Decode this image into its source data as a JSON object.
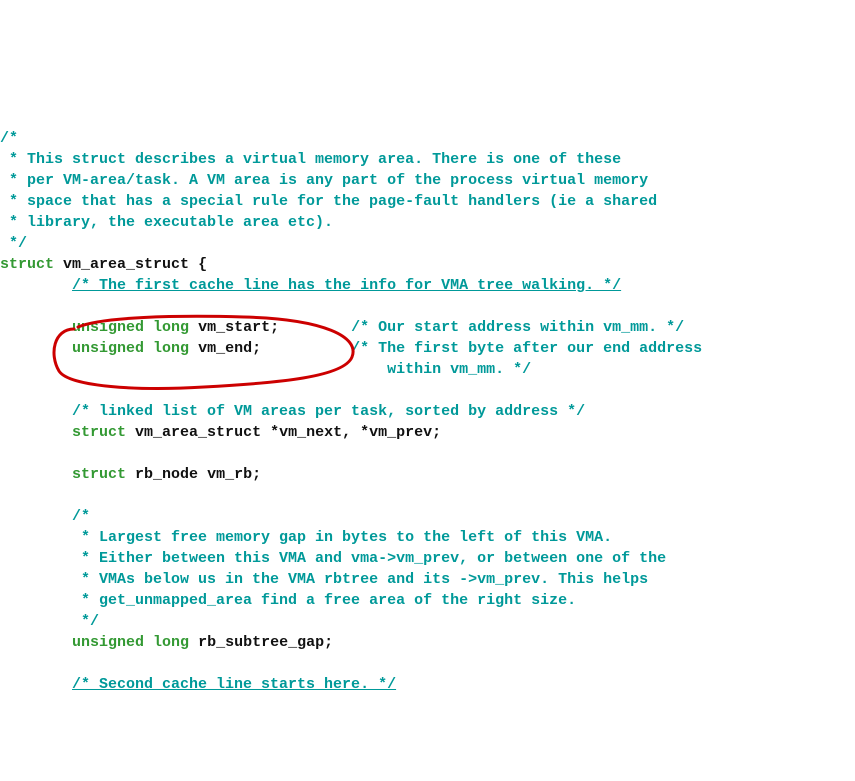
{
  "code": {
    "c1_l1": "/*",
    "c1_l2": " * This struct describes a virtual memory area. There is one of these",
    "c1_l3": " * per VM-area/task. A VM area is any part of the process virtual memory",
    "c1_l4": " * space that has a special rule for the page-fault handlers (ie a shared",
    "c1_l5": " * library, the executable area etc).",
    "c1_l6": " */",
    "kw_struct": "struct",
    "id_vm_area_struct": "vm_area_struct",
    "brace_open": " {",
    "c2": "/* The first cache line has the info for VMA tree walking. */",
    "kw_unsigned": "unsigned",
    "kw_long": "long",
    "id_vm_start": "vm_start",
    "id_vm_end": "vm_end",
    "semi": ";",
    "c3": "/* Our start address within vm_mm. */",
    "c4_l1": "/* The first byte after our end address",
    "c4_l2": "   within vm_mm. */",
    "c5": "/* linked list of VM areas per task, sorted by address */",
    "id_vm_next": "*vm_next",
    "id_vm_prev": "*vm_prev",
    "comma": ", ",
    "id_rb_node": "rb_node",
    "id_vm_rb": "vm_rb",
    "c6_l1": "/*",
    "c6_l2": " * Largest free memory gap in bytes to the left of this VMA.",
    "c6_l3": " * Either between this VMA and vma->vm_prev, or between one of the",
    "c6_l4": " * VMAs below us in the VMA rbtree and its ->vm_prev. This helps",
    "c6_l5": " * get_unmapped_area find a free area of the right size.",
    "c6_l6": " */",
    "id_rb_subtree_gap": "rb_subtree_gap",
    "c7": "/* Second cache line starts here. */"
  }
}
